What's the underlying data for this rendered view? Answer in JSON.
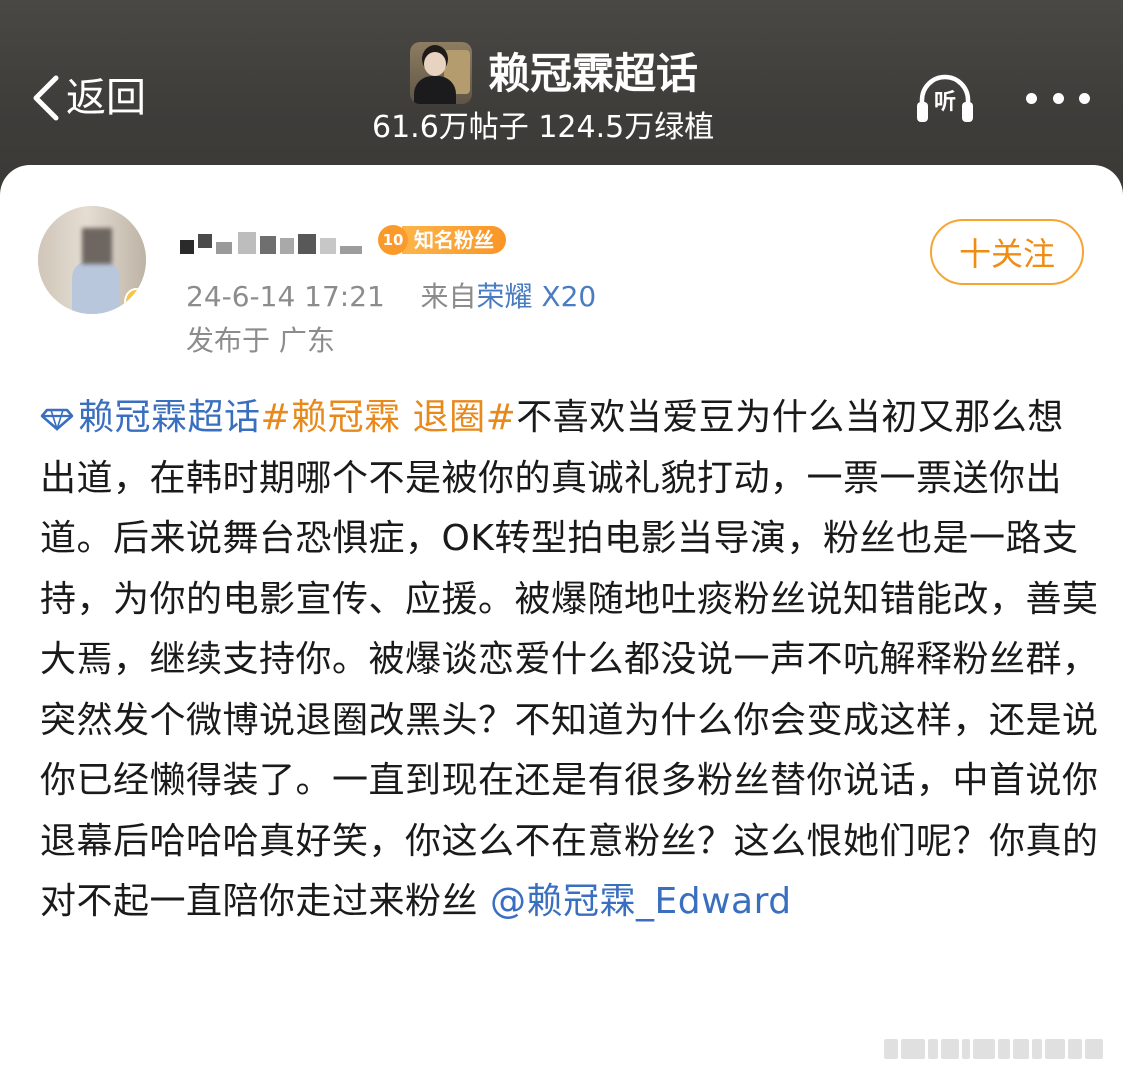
{
  "header": {
    "back_label": "返回",
    "topic_title": "赖冠霖超话",
    "topic_stats": "61.6万帖子 124.5万绿植",
    "listen_label": "听"
  },
  "post": {
    "fan_badge_level": "10",
    "fan_badge_label": "知名粉丝",
    "follow_label": "十关注",
    "timestamp": "24-6-14 17:21",
    "source_prefix": "来自",
    "source_device": "荣耀 X20",
    "location": "发布于 广东",
    "supertopic": "赖冠霖超话",
    "hashtag": "#赖冠霖 退圈#",
    "body": "不喜欢当爱豆为什么当初又那么想出道，在韩时期哪个不是被你的真诚礼貌打动，一票一票送你出道。后来说舞台恐惧症，OK转型拍电影当导演，粉丝也是一路支持，为你的电影宣传、应援。被爆随地吐痰粉丝说知错能改，善莫大焉，继续支持你。被爆谈恋爱什么都没说一声不吭解释粉丝群，突然发个微博说退圈改黑头？不知道为什么你会变成这样，还是说你已经懒得装了。一直到现在还是有很多粉丝替你说话，中首说你退幕后哈哈哈真好笑，你这么不在意粉丝？这么恨她们呢？你真的对不起一直陪你走过来粉丝",
    "mention": "@赖冠霖_Edward"
  },
  "colors": {
    "header_bg": "#3f3d3a",
    "link_blue": "#3a6fc0",
    "hashtag_orange": "#e8891c",
    "follow_orange": "#f08c12",
    "meta_gray": "#8c8c8c"
  },
  "icons": {
    "back": "chevron-left-icon",
    "listen": "headphones-icon",
    "more": "more-dots-icon",
    "supertopic": "diamond-icon"
  }
}
